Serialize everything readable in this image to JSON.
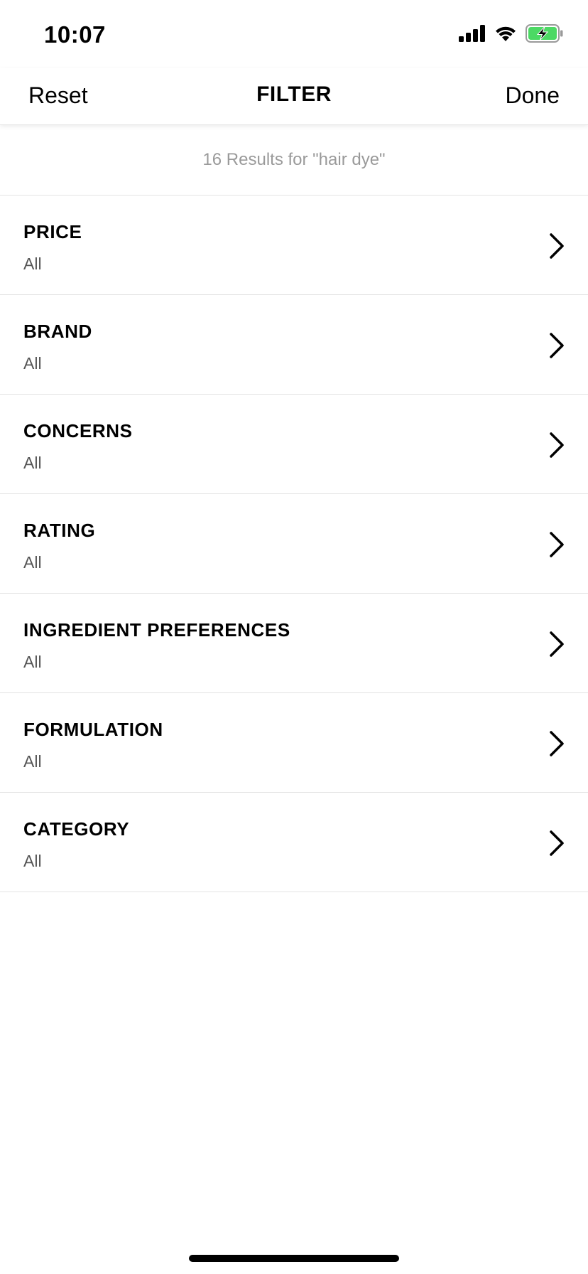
{
  "status_bar": {
    "time": "10:07",
    "icons": [
      "cellular-signal-icon",
      "wifi-icon",
      "battery-charging-icon"
    ],
    "battery_color": "#4cd964"
  },
  "nav": {
    "reset_label": "Reset",
    "title": "FILTER",
    "done_label": "Done"
  },
  "results_text": "16 Results for \"hair dye\"",
  "filters": [
    {
      "label": "PRICE",
      "value": "All"
    },
    {
      "label": "BRAND",
      "value": "All"
    },
    {
      "label": "CONCERNS",
      "value": "All"
    },
    {
      "label": "RATING",
      "value": "All"
    },
    {
      "label": "INGREDIENT PREFERENCES",
      "value": "All"
    },
    {
      "label": "FORMULATION",
      "value": "All"
    },
    {
      "label": "CATEGORY",
      "value": "All"
    }
  ]
}
